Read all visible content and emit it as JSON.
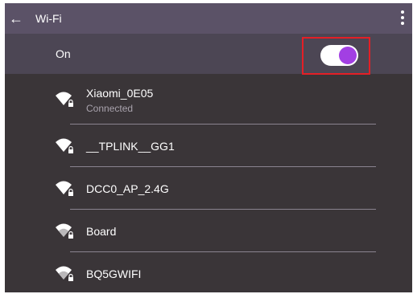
{
  "header": {
    "back_icon": "arrow-left-icon",
    "title": "Wi-Fi",
    "more_icon": "more-vert-icon"
  },
  "wifi_toggle": {
    "label": "On",
    "state": "on",
    "colors": {
      "track": "#ffffff",
      "knob": "#a23fe3",
      "highlight_border": "#e41f26"
    }
  },
  "networks": [
    {
      "ssid": "Xiaomi_0E05",
      "status": "Connected",
      "icon": "wifi-lock-icon"
    },
    {
      "ssid": "__TPLINK__GG1",
      "status": "",
      "icon": "wifi-lock-icon"
    },
    {
      "ssid": "DCC0_AP_2.4G",
      "status": "",
      "icon": "wifi-lock-icon"
    },
    {
      "ssid": "Board",
      "status": "",
      "icon": "wifi-lock-icon"
    },
    {
      "ssid": "BQ5GWIFI",
      "status": "",
      "icon": "wifi-lock-icon"
    }
  ],
  "colors": {
    "app_bar": "#5b5267",
    "toggle_row": "#4c4654",
    "background": "#3a3538",
    "divider": "#8a8490"
  }
}
